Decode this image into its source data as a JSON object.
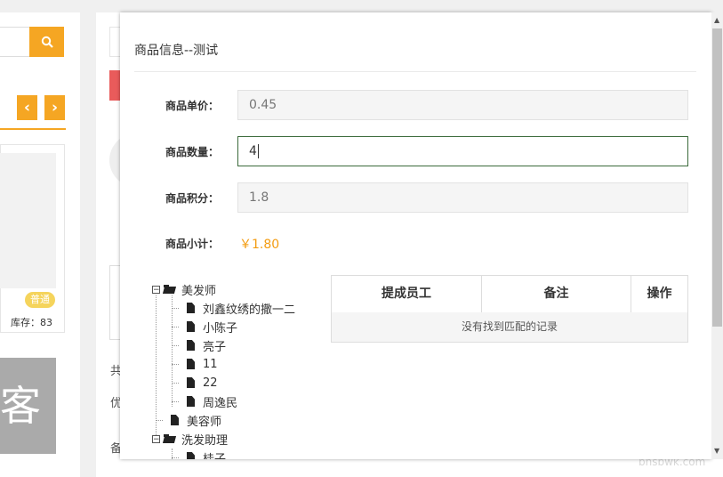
{
  "background": {
    "search_icon": "search-icon",
    "prev_icon": "‹",
    "next_icon": "›",
    "tag": "普通",
    "stock": "库存：83",
    "card_text": "客",
    "side_labels": [
      "共",
      "优",
      "备"
    ],
    "watermark": "bhsbwk.com"
  },
  "modal": {
    "title": "商品信息--测试",
    "fields": {
      "price_label": "商品单价：",
      "price_value": "0.45",
      "qty_label": "商品数量：",
      "qty_value": "4",
      "points_label": "商品积分：",
      "points_value": "1.8",
      "subtotal_label": "商品小计：",
      "subtotal_value": "￥1.80"
    },
    "tree": {
      "groups": [
        {
          "label": "美发师",
          "expanded": true,
          "children": [
            "刘鑫纹绣的撒一二",
            "小陈子",
            "亮子",
            "11",
            "22",
            "周逸民"
          ]
        },
        {
          "label": "美容师",
          "expanded": false,
          "children": []
        },
        {
          "label": "洗发助理",
          "expanded": true,
          "children": [
            "桂子"
          ]
        }
      ]
    },
    "table": {
      "headers": [
        "提成员工",
        "备注",
        "操作"
      ],
      "empty_text": "没有找到匹配的记录"
    }
  },
  "colors": {
    "accent": "#f5a623",
    "subtotal": "#f39c12",
    "active_border": "#3b6a3b"
  }
}
